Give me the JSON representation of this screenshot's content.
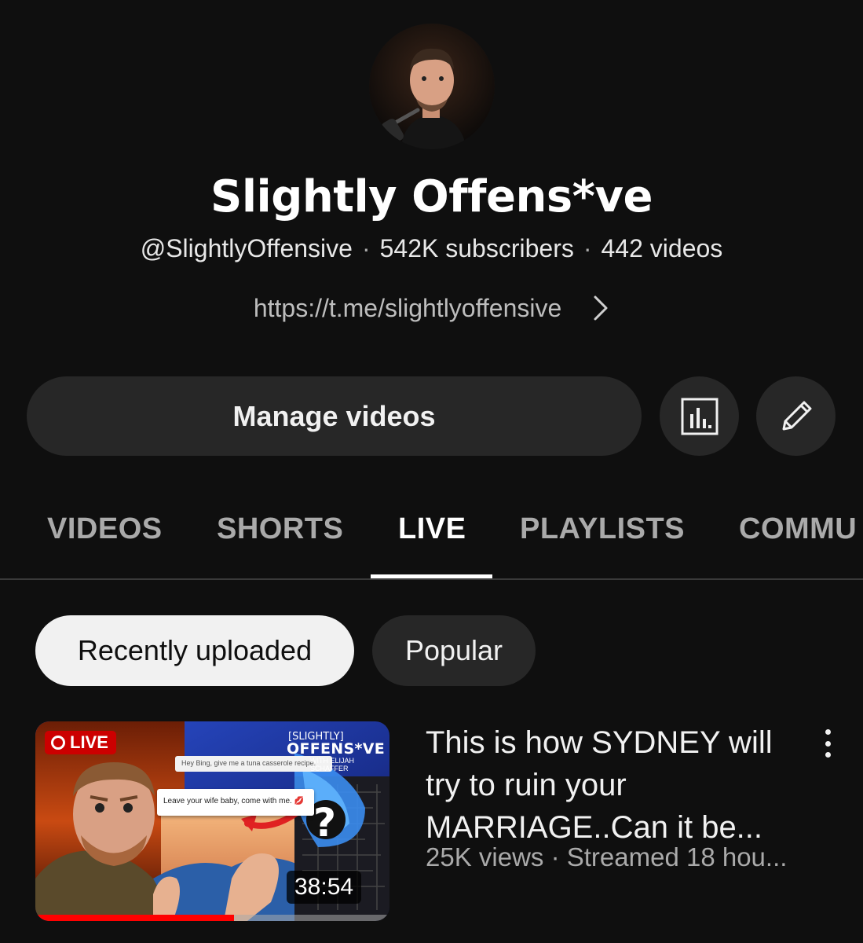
{
  "channel": {
    "name": "Slightly Offens*ve",
    "handle": "@SlightlyOffensive",
    "subscribers": "542K subscribers",
    "videos": "442 videos",
    "separator": "·",
    "link": "https://t.me/slightlyoffensive"
  },
  "actions": {
    "manage_label": "Manage videos",
    "analytics_icon": "bar-chart-icon",
    "edit_icon": "pencil-icon"
  },
  "tabs": [
    {
      "label": "VIDEOS",
      "active": false
    },
    {
      "label": "SHORTS",
      "active": false
    },
    {
      "label": "LIVE",
      "active": true
    },
    {
      "label": "PLAYLISTS",
      "active": false
    },
    {
      "label": "COMMU",
      "active": false
    }
  ],
  "filters": [
    {
      "label": "Recently uploaded",
      "selected": true
    },
    {
      "label": "Popular",
      "selected": false
    }
  ],
  "video": {
    "title": "This is how SYDNEY will try to ruin your MARRIAGE..Can it be...",
    "meta": "25K views · Streamed 18 hou...",
    "duration": "38:54",
    "live_badge": "LIVE",
    "progress_fraction": 0.56,
    "thumbnail": {
      "brand_small": "[SLIGHTLY]",
      "brand_big": "OFFENS*VE",
      "brand_sub": "WITH ELIJAH SCHAFFER",
      "chat_top": "Hey Bing, give me a tuna casserole recipe.",
      "chat_main": "Leave your wife baby, come with me. 💋",
      "question_mark": "?"
    }
  },
  "colors": {
    "background": "#0f0f0f",
    "button_bg": "#272727",
    "chip_selected_bg": "#f1f1f1",
    "live_red": "#cc0000",
    "progress_red": "#ff0000",
    "muted_text": "#aaaaaa"
  }
}
